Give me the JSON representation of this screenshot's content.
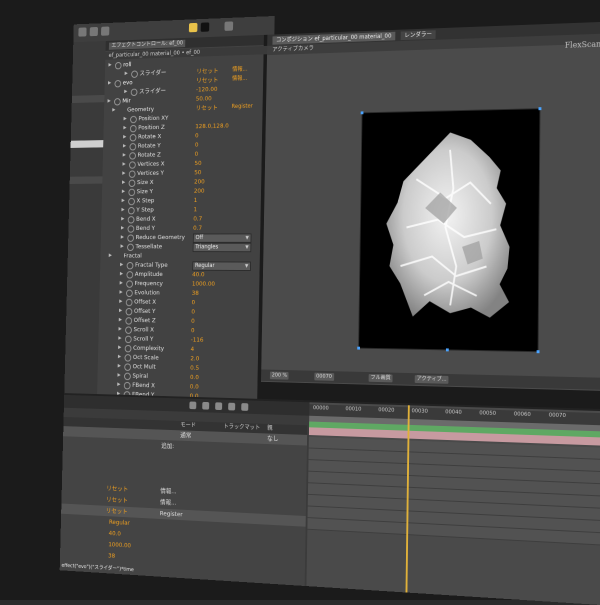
{
  "panel_tabs": {
    "effect_controls": "エフェクトコントロール: ef_00",
    "title_sub": "ef_particular_00 material_00 • ef_00",
    "comp": "コンポジション ef_particular_00 material_00",
    "render": "レンダラー",
    "camera": "アクティブカメラ"
  },
  "effect_rows": [
    {
      "type": "group",
      "name": "roll"
    },
    {
      "type": "param",
      "name": "スライダー",
      "value": "リセット",
      "value2": "情報..."
    },
    {
      "type": "group",
      "name": "evo",
      "value": "リセット",
      "value2": "情報..."
    },
    {
      "type": "param",
      "name": "スライダー",
      "value": "-120.00"
    },
    {
      "type": "group",
      "name": "Mir",
      "value": "50.00"
    },
    {
      "type": "subgroup",
      "name": "Geometry",
      "value": "リセット",
      "value2": "Register"
    },
    {
      "type": "param",
      "name": "Position XY"
    },
    {
      "type": "param",
      "name": "Position Z",
      "value": "128.0,128.0"
    },
    {
      "type": "param",
      "name": "Rotate X",
      "value": "0"
    },
    {
      "type": "param",
      "name": "Rotate Y",
      "value": "0"
    },
    {
      "type": "param",
      "name": "Rotate Z",
      "value": "0"
    },
    {
      "type": "param",
      "name": "Vertices X",
      "value": "50"
    },
    {
      "type": "param",
      "name": "Vertices Y",
      "value": "50"
    },
    {
      "type": "param",
      "name": "Size X",
      "value": "200"
    },
    {
      "type": "param",
      "name": "Size Y",
      "value": "200"
    },
    {
      "type": "param",
      "name": "X Step",
      "value": "1"
    },
    {
      "type": "param",
      "name": "Y Step",
      "value": "1"
    },
    {
      "type": "param",
      "name": "Bend X",
      "value": "0.7"
    },
    {
      "type": "param",
      "name": "Bend Y",
      "value": "0.7"
    },
    {
      "type": "param",
      "name": "Reduce Geometry",
      "select": "Off"
    },
    {
      "type": "param",
      "name": "Tessellate",
      "select": "Triangles"
    },
    {
      "type": "subgroup",
      "name": "Fractal"
    },
    {
      "type": "param",
      "name": "Fractal Type",
      "select": "Regular"
    },
    {
      "type": "param",
      "name": "Amplitude",
      "value": "40.0"
    },
    {
      "type": "param",
      "name": "Frequency",
      "value": "1000.00"
    },
    {
      "type": "param",
      "name": "Evolution",
      "value": "38"
    },
    {
      "type": "param",
      "name": "Offset X",
      "value": "0"
    },
    {
      "type": "param",
      "name": "Offset Y",
      "value": "0"
    },
    {
      "type": "param",
      "name": "Offset Z",
      "value": "0"
    },
    {
      "type": "param",
      "name": "Scroll X",
      "value": "0"
    },
    {
      "type": "param",
      "name": "Scroll Y",
      "value": "-116"
    },
    {
      "type": "param",
      "name": "Complexity",
      "value": "4"
    },
    {
      "type": "param",
      "name": "Oct Scale",
      "value": "2.0"
    },
    {
      "type": "param",
      "name": "Oct Mult",
      "value": "0.5"
    },
    {
      "type": "param",
      "name": "Spiral",
      "value": "0.0"
    },
    {
      "type": "param",
      "name": "FBend X",
      "value": "0.0"
    },
    {
      "type": "param",
      "name": "FBend Y",
      "value": "0.0"
    }
  ],
  "viewer_bar": {
    "zoom": "200 %",
    "timecode": "00070",
    "res": "フル画質",
    "camera": "アクティブ..."
  },
  "timeline": {
    "col_mode": "モード",
    "col_track": "トラックマット",
    "col_parent": "親",
    "mode_value": "通常",
    "parent_value": "なし",
    "add_label": "追加:",
    "ruler": [
      "00000",
      "00010",
      "00020",
      "00030",
      "00040",
      "00050",
      "00060",
      "00070"
    ],
    "rows": [
      {
        "v": "リセット",
        "n": "情報..."
      },
      {
        "v": "リセット",
        "n": "情報..."
      },
      {
        "v": "リセット",
        "n": "Register"
      },
      {
        "v": "Regular",
        "n": ""
      },
      {
        "v": "40.0",
        "n": ""
      },
      {
        "v": "1000.00",
        "n": ""
      },
      {
        "v": "38",
        "n": ""
      }
    ],
    "expression": "effect(\"evo\")(\"スライダー\")*time"
  },
  "brand": "FlexScan"
}
